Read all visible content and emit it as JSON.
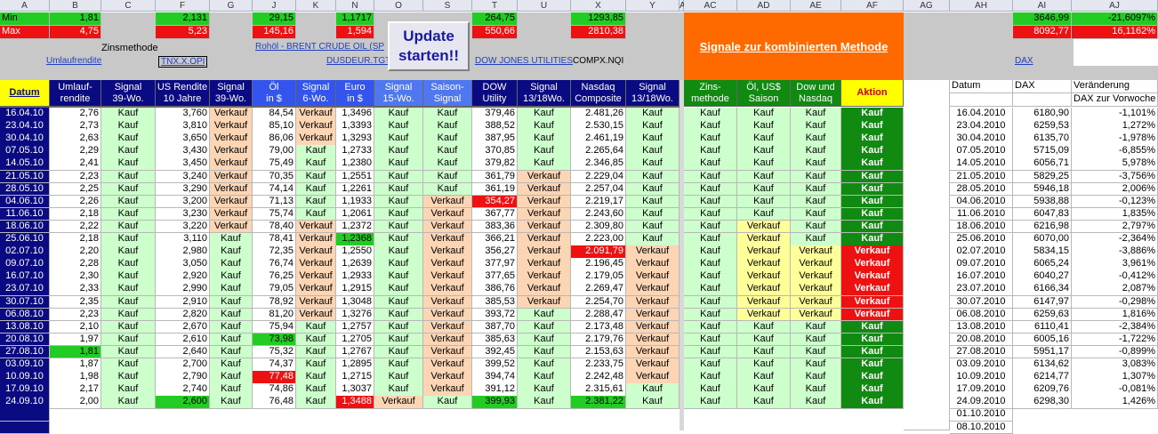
{
  "column_letters": [
    "A",
    "B",
    "C",
    "F",
    "G",
    "J",
    "K",
    "N",
    "O",
    "T",
    "U",
    "X",
    "Y",
    "AC",
    "AD",
    "AE",
    "AF",
    "AG",
    "AH",
    "AI",
    "AJ"
  ],
  "minmax": {
    "min_label": "Min",
    "max_label": "Max",
    "min": {
      "B": "1,81",
      "F": "2,131",
      "J": "29,15",
      "N": "1,1717",
      "T": "264,75",
      "X": "1293,85",
      "AI": "3646,99",
      "AJ": "-21,6097%"
    },
    "max": {
      "B": "4,75",
      "F": "5,23",
      "J": "145,16",
      "N": "1,594",
      "T": "550,66",
      "X": "2810,38",
      "AI": "8092,77",
      "AJ": "16,1162%"
    }
  },
  "sources": {
    "zinsmethode": "Zinsmethode",
    "umlauf_link": "Umlaufrendite",
    "tnx_link": "TNX.X.OPI",
    "oil_link": "Rohöl - BRENT CRUDE OIL (SP",
    "usdeur_link": "DUSDEUR.TGT",
    "dow_link": "DOW JONES UTILITIES",
    "compx": "COMPX.NQI",
    "dax_link": "DAX"
  },
  "update_button": "Update starten!!",
  "signal_banner": "Signale zur kombinierten Methode",
  "headers": {
    "A": "Datum",
    "B": "Umlauf-\nrendite",
    "C": "Signal\n39-Wo.",
    "F": "US Rendite\n10 Jahre",
    "G": "Signal\n39-Wo.",
    "J": "Öl\nin $",
    "K": "Signal\n6-Wo.",
    "N": "Euro\nin $",
    "O": "Signal\n15-Wo.",
    "S": "Saison-\nSignal",
    "T": "DOW\nUtility",
    "U": "Signal\n13/18Wo.",
    "X": "Nasdaq\nComposite",
    "Y": "Signal\n13/18Wo.",
    "AC": "Zins-\nmethode",
    "AD": "Öl, US$\nSaison",
    "AE": "Dow und\nNasdaq",
    "AF": "Aktion",
    "AH": "Datum",
    "AI": "DAX",
    "AJ": "Veränderung",
    "AJ2": "DAX zur Vorwoche"
  },
  "rows": [
    [
      "16.04.10",
      "2,76",
      "Kauf",
      "3,760",
      "Verkauf",
      "84,54",
      "Verkauf",
      "1,3496",
      "Kauf",
      "Kauf",
      "379,46",
      "Kauf",
      "2.481,26",
      "Kauf",
      "Kauf",
      "Kauf",
      "Kauf",
      "Kauf",
      "16.04.2010",
      "6180,90",
      "-1,101%"
    ],
    [
      "23.04.10",
      "2,73",
      "Kauf",
      "3,810",
      "Verkauf",
      "85,10",
      "Verkauf",
      "1,3393",
      "Kauf",
      "Kauf",
      "388,52",
      "Kauf",
      "2.530,15",
      "Kauf",
      "Kauf",
      "Kauf",
      "Kauf",
      "Kauf",
      "23.04.2010",
      "6259,53",
      "1,272%"
    ],
    [
      "30.04.10",
      "2,63",
      "Kauf",
      "3,650",
      "Verkauf",
      "86,06",
      "Verkauf",
      "1,3293",
      "Kauf",
      "Kauf",
      "387,95",
      "Kauf",
      "2.461,19",
      "Kauf",
      "Kauf",
      "Kauf",
      "Kauf",
      "Kauf",
      "30.04.2010",
      "6135,70",
      "-1,978%"
    ],
    [
      "07.05.10",
      "2,29",
      "Kauf",
      "3,430",
      "Verkauf",
      "79,00",
      "Kauf",
      "1,2733",
      "Kauf",
      "Kauf",
      "370,85",
      "Kauf",
      "2.265,64",
      "Kauf",
      "Kauf",
      "Kauf",
      "Kauf",
      "Kauf",
      "07.05.2010",
      "5715,09",
      "-6,855%"
    ],
    [
      "14.05.10",
      "2,41",
      "Kauf",
      "3,450",
      "Verkauf",
      "75,49",
      "Kauf",
      "1,2380",
      "Kauf",
      "Kauf",
      "379,82",
      "Kauf",
      "2.346,85",
      "Kauf",
      "Kauf",
      "Kauf",
      "Kauf",
      "Kauf",
      "14.05.2010",
      "6056,71",
      "5,978%"
    ],
    [
      "21.05.10",
      "2,23",
      "Kauf",
      "3,240",
      "Verkauf",
      "70,35",
      "Kauf",
      "1,2551",
      "Kauf",
      "Kauf",
      "361,79",
      "Verkauf",
      "2.229,04",
      "Kauf",
      "Kauf",
      "Kauf",
      "Kauf",
      "Kauf",
      "21.05.2010",
      "5829,25",
      "-3,756%"
    ],
    [
      "28.05.10",
      "2,25",
      "Kauf",
      "3,290",
      "Verkauf",
      "74,14",
      "Kauf",
      "1,2261",
      "Kauf",
      "Kauf",
      "361,19",
      "Verkauf",
      "2.257,04",
      "Kauf",
      "Kauf",
      "Kauf",
      "Kauf",
      "Kauf",
      "28.05.2010",
      "5946,18",
      "2,006%"
    ],
    [
      "04.06.10",
      "2,26",
      "Kauf",
      "3,200",
      "Verkauf",
      "71,13",
      "Kauf",
      "1,1933",
      "Kauf",
      "Verkauf",
      "354,27",
      "Verkauf",
      "2.219,17",
      "Kauf",
      "Kauf",
      "Kauf",
      "Kauf",
      "Kauf",
      "04.06.2010",
      "5938,88",
      "-0,123%"
    ],
    [
      "11.06.10",
      "2,18",
      "Kauf",
      "3,230",
      "Verkauf",
      "75,74",
      "Kauf",
      "1,2061",
      "Kauf",
      "Verkauf",
      "367,77",
      "Verkauf",
      "2.243,60",
      "Kauf",
      "Kauf",
      "Kauf",
      "Kauf",
      "Kauf",
      "11.06.2010",
      "6047,83",
      "1,835%"
    ],
    [
      "18.06.10",
      "2,22",
      "Kauf",
      "3,220",
      "Verkauf",
      "78,40",
      "Verkauf",
      "1,2372",
      "Kauf",
      "Verkauf",
      "383,36",
      "Verkauf",
      "2.309,80",
      "Kauf",
      "Kauf",
      "Verkauf",
      "Kauf",
      "Kauf",
      "18.06.2010",
      "6216,98",
      "2,797%"
    ],
    [
      "25.06.10",
      "2,18",
      "Kauf",
      "3,110",
      "Kauf",
      "78,41",
      "Verkauf",
      "1,2368",
      "Kauf",
      "Verkauf",
      "366,21",
      "Verkauf",
      "2.223,00",
      "Kauf",
      "Kauf",
      "Verkauf",
      "Kauf",
      "Kauf",
      "25.06.2010",
      "6070,00",
      "-2,364%"
    ],
    [
      "02.07.10",
      "2,20",
      "Kauf",
      "2,980",
      "Kauf",
      "72,35",
      "Verkauf",
      "1,2550",
      "Kauf",
      "Verkauf",
      "356,27",
      "Verkauf",
      "2.091,79",
      "Verkauf",
      "Kauf",
      "Verkauf",
      "Verkauf",
      "Verkauf",
      "02.07.2010",
      "5834,15",
      "-3,886%"
    ],
    [
      "09.07.10",
      "2,28",
      "Kauf",
      "3,050",
      "Kauf",
      "76,74",
      "Verkauf",
      "1,2639",
      "Kauf",
      "Verkauf",
      "377,97",
      "Verkauf",
      "2.196,45",
      "Verkauf",
      "Kauf",
      "Verkauf",
      "Verkauf",
      "Verkauf",
      "09.07.2010",
      "6065,24",
      "3,961%"
    ],
    [
      "16.07.10",
      "2,30",
      "Kauf",
      "2,920",
      "Kauf",
      "76,25",
      "Verkauf",
      "1,2933",
      "Kauf",
      "Verkauf",
      "377,65",
      "Verkauf",
      "2.179,05",
      "Verkauf",
      "Kauf",
      "Verkauf",
      "Verkauf",
      "Verkauf",
      "16.07.2010",
      "6040,27",
      "-0,412%"
    ],
    [
      "23.07.10",
      "2,33",
      "Kauf",
      "2,990",
      "Kauf",
      "79,05",
      "Verkauf",
      "1,2915",
      "Kauf",
      "Verkauf",
      "386,76",
      "Verkauf",
      "2.269,47",
      "Verkauf",
      "Kauf",
      "Verkauf",
      "Verkauf",
      "Verkauf",
      "23.07.2010",
      "6166,34",
      "2,087%"
    ],
    [
      "30.07.10",
      "2,35",
      "Kauf",
      "2,910",
      "Kauf",
      "78,92",
      "Verkauf",
      "1,3048",
      "Kauf",
      "Verkauf",
      "385,53",
      "Verkauf",
      "2.254,70",
      "Verkauf",
      "Kauf",
      "Verkauf",
      "Verkauf",
      "Verkauf",
      "30.07.2010",
      "6147,97",
      "-0,298%"
    ],
    [
      "06.08.10",
      "2,23",
      "Kauf",
      "2,820",
      "Kauf",
      "81,20",
      "Verkauf",
      "1,3276",
      "Kauf",
      "Verkauf",
      "393,72",
      "Kauf",
      "2.288,47",
      "Verkauf",
      "Kauf",
      "Verkauf",
      "Verkauf",
      "Verkauf",
      "06.08.2010",
      "6259,63",
      "1,816%"
    ],
    [
      "13.08.10",
      "2,10",
      "Kauf",
      "2,670",
      "Kauf",
      "75,94",
      "Kauf",
      "1,2757",
      "Kauf",
      "Verkauf",
      "387,70",
      "Kauf",
      "2.173,48",
      "Verkauf",
      "Kauf",
      "Kauf",
      "Kauf",
      "Kauf",
      "13.08.2010",
      "6110,41",
      "-2,384%"
    ],
    [
      "20.08.10",
      "1,97",
      "Kauf",
      "2,610",
      "Kauf",
      "73,98",
      "Kauf",
      "1,2705",
      "Kauf",
      "Verkauf",
      "385,63",
      "Kauf",
      "2.179,76",
      "Verkauf",
      "Kauf",
      "Kauf",
      "Kauf",
      "Kauf",
      "20.08.2010",
      "6005,16",
      "-1,722%"
    ],
    [
      "27.08.10",
      "1,81",
      "Kauf",
      "2,640",
      "Kauf",
      "75,32",
      "Kauf",
      "1,2767",
      "Kauf",
      "Verkauf",
      "392,45",
      "Kauf",
      "2.153,63",
      "Verkauf",
      "Kauf",
      "Kauf",
      "Kauf",
      "Kauf",
      "27.08.2010",
      "5951,17",
      "-0,899%"
    ],
    [
      "03.09.10",
      "1,87",
      "Kauf",
      "2,700",
      "Kauf",
      "74,37",
      "Kauf",
      "1,2895",
      "Kauf",
      "Verkauf",
      "399,52",
      "Kauf",
      "2.233,75",
      "Verkauf",
      "Kauf",
      "Kauf",
      "Kauf",
      "Kauf",
      "03.09.2010",
      "6134,62",
      "3,083%"
    ],
    [
      "10.09.10",
      "1,98",
      "Kauf",
      "2,790",
      "Kauf",
      "77,48",
      "Kauf",
      "1,2715",
      "Kauf",
      "Verkauf",
      "394,74",
      "Kauf",
      "2.242,48",
      "Verkauf",
      "Kauf",
      "Kauf",
      "Kauf",
      "Kauf",
      "10.09.2010",
      "6214,77",
      "1,307%"
    ],
    [
      "17.09.10",
      "2,17",
      "Kauf",
      "2,740",
      "Kauf",
      "74,86",
      "Kauf",
      "1,3037",
      "Kauf",
      "Verkauf",
      "391,12",
      "Kauf",
      "2.315,61",
      "Kauf",
      "Kauf",
      "Kauf",
      "Kauf",
      "Kauf",
      "17.09.2010",
      "6209,76",
      "-0,081%"
    ],
    [
      "24.09.10",
      "2,00",
      "Kauf",
      "2,600",
      "Kauf",
      "76,48",
      "Kauf",
      "1,3488",
      "Verkauf",
      "Kauf",
      "399,93",
      "Kauf",
      "2.381,22",
      "Kauf",
      "Kauf",
      "Kauf",
      "Kauf",
      "Kauf",
      "24.09.2010",
      "6298,30",
      "1,426%"
    ]
  ],
  "extra_dates": [
    "01.10.2010",
    "08.10.2010"
  ],
  "colors": {
    "dark_blue": "#0a0a82",
    "blue_header": "#3355ee",
    "light_blue_header": "#4f78f0",
    "kauf_green": "#ccffcc",
    "verkauf_orange": "#fcd5b4",
    "bright_green": "#22cc22",
    "red": "#ee1111",
    "dark_green": "#108a10",
    "orange_banner": "#ff6a00",
    "yellow_header": "#ffff00",
    "verkauf_yellow": "#ffff99"
  },
  "cell_highlights": [
    {
      "row": 19,
      "col": "B",
      "color": "#22cc22"
    },
    {
      "row": 10,
      "col": "N",
      "color": "#22cc22"
    },
    {
      "row": 18,
      "col": "J",
      "color": "#22cc22"
    },
    {
      "row": 21,
      "col": "J",
      "color": "#ee1111"
    },
    {
      "row": 7,
      "col": "T",
      "color": "#ee1111"
    },
    {
      "row": 11,
      "col": "X",
      "color": "#ee1111"
    },
    {
      "row": 23,
      "col": "F",
      "color": "#22cc22"
    },
    {
      "row": 23,
      "col": "N",
      "color": "#ee1111"
    },
    {
      "row": 23,
      "col": "T",
      "color": "#22cc22"
    },
    {
      "row": 23,
      "col": "X",
      "color": "#22cc22"
    }
  ]
}
